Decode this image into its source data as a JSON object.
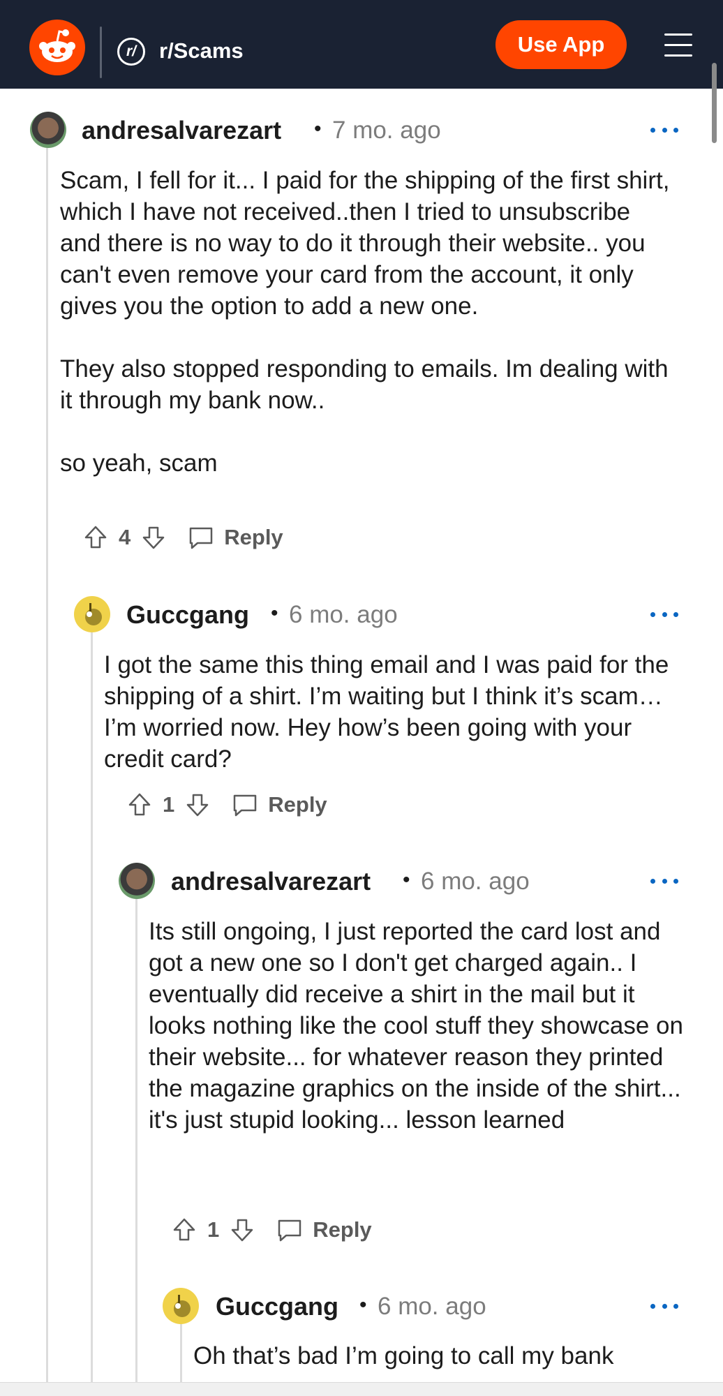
{
  "header": {
    "subreddit": "r/Scams",
    "subreddit_icon_text": "r/",
    "use_app_label": "Use App"
  },
  "comments": [
    {
      "username": "andresalvarezart",
      "time": "7 mo. ago",
      "paragraphs": [
        "Scam, I fell for it... I paid for the shipping of the first shirt, which I have not received..then I tried to unsubscribe and there is no way to do it through their website.. you can't even remove your card from the account, it only gives you the option to add a new one.",
        "They also stopped responding to emails. Im dealing with it through my bank now..",
        "so yeah, scam"
      ],
      "votes": "4",
      "reply_label": "Reply"
    },
    {
      "username": "Guccgang",
      "time": "6 mo. ago",
      "paragraphs": [
        "I got the same this thing email and I was paid for the shipping of a shirt. I’m waiting but I think it’s scam… I’m worried now. Hey how’s been going with your credit card?"
      ],
      "votes": "1",
      "reply_label": "Reply"
    },
    {
      "username": "andresalvarezart",
      "time": "6 mo. ago",
      "paragraphs": [
        "Its still ongoing, I just reported the card lost and got a new one so I don't get charged again.. I eventually did receive a shirt in the mail but it looks nothing like the cool stuff they showcase on their website... for whatever reason they printed the magazine graphics on the inside of the shirt... it's just stupid looking... lesson learned"
      ],
      "votes": "1",
      "reply_label": "Reply"
    },
    {
      "username": "Guccgang",
      "time": "6 mo. ago",
      "paragraphs": [
        "Oh that’s bad I’m going to call my bank"
      ]
    }
  ],
  "colors": {
    "header_bg": "#1a2233",
    "accent": "#ff4500",
    "more_dots": "#0a66c2"
  }
}
